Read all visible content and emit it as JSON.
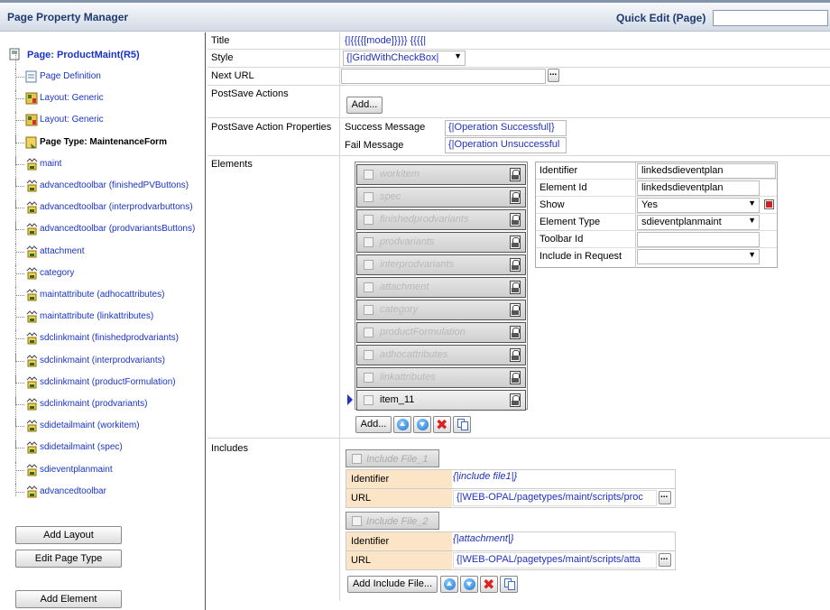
{
  "header": {
    "title": "Page Property Manager",
    "quick_edit_label": "Quick Edit (Page)",
    "quick_edit_value": ""
  },
  "tree": {
    "root": "Page: ProductMaint(R5)",
    "items": [
      {
        "label": "Page Definition",
        "bold": false,
        "icon": "page-doc-icon"
      },
      {
        "label": "Layout: Generic",
        "bold": false,
        "icon": "layout-icon"
      },
      {
        "label": "Layout: Generic",
        "bold": false,
        "icon": "layout-icon"
      },
      {
        "label": "Page Type: MaintenanceForm",
        "bold": true,
        "icon": "page-type-icon"
      },
      {
        "label": "maint",
        "bold": false,
        "icon": "element-icon"
      },
      {
        "label": "advancedtoolbar (finishedPVButtons)",
        "bold": false,
        "icon": "element-icon"
      },
      {
        "label": "advancedtoolbar (interprodvarbuttons)",
        "bold": false,
        "icon": "element-icon"
      },
      {
        "label": "advancedtoolbar (prodvariantsButtons)",
        "bold": false,
        "icon": "element-icon"
      },
      {
        "label": "attachment",
        "bold": false,
        "icon": "element-icon"
      },
      {
        "label": "category",
        "bold": false,
        "icon": "element-icon"
      },
      {
        "label": "maintattribute (adhocattributes)",
        "bold": false,
        "icon": "element-icon"
      },
      {
        "label": "maintattribute (linkattributes)",
        "bold": false,
        "icon": "element-icon"
      },
      {
        "label": "sdclinkmaint (finishedprodvariants)",
        "bold": false,
        "icon": "element-icon"
      },
      {
        "label": "sdclinkmaint (interprodvariants)",
        "bold": false,
        "icon": "element-icon"
      },
      {
        "label": "sdclinkmaint (productFormulation)",
        "bold": false,
        "icon": "element-icon"
      },
      {
        "label": "sdclinkmaint (prodvariants)",
        "bold": false,
        "icon": "element-icon"
      },
      {
        "label": "sdidetailmaint (workitem)",
        "bold": false,
        "icon": "element-icon"
      },
      {
        "label": "sdidetailmaint (spec)",
        "bold": false,
        "icon": "element-icon"
      },
      {
        "label": "sdieventplanmaint",
        "bold": false,
        "icon": "element-icon"
      },
      {
        "label": "advancedtoolbar",
        "bold": false,
        "icon": "element-icon"
      }
    ],
    "buttons": {
      "add_layout": "Add Layout",
      "edit_page_type": "Edit Page Type",
      "add_element": "Add Element"
    }
  },
  "main": {
    "title": {
      "label": "Title",
      "value": "{|{{{{[mode]}}}} {{{{|"
    },
    "style": {
      "label": "Style",
      "value": "{|GridWithCheckBox|"
    },
    "next_url": {
      "label": "Next URL",
      "value": ""
    },
    "postsave": {
      "label": "PostSave Actions",
      "add": "Add..."
    },
    "postsave_props": {
      "label": "PostSave Action Properties",
      "success_label": "Success Message",
      "success_value": "{|Operation Successful|}",
      "fail_label": "Fail Message",
      "fail_value": "{|Operation Unsuccessful"
    },
    "elements": {
      "label": "Elements",
      "items": [
        "workitem",
        "spec",
        "finishedprodvariants",
        "prodvariants",
        "interprodvariants",
        "attachment",
        "category",
        "productFormulation",
        "adhocattributes",
        "linkattributes",
        "item_11"
      ],
      "add": "Add...",
      "props": {
        "identifier_label": "Identifier",
        "identifier_value": "linkedsdieventplan",
        "element_id_label": "Element Id",
        "element_id_value": "linkedsdieventplan",
        "show_label": "Show",
        "show_value": "Yes",
        "type_label": "Element Type",
        "type_value": "sdieventplanmaint",
        "toolbar_label": "Toolbar Id",
        "toolbar_value": "",
        "include_label": "Include in Request",
        "include_value": ""
      }
    },
    "includes": {
      "label": "Includes",
      "files": [
        {
          "name": "Include File_1",
          "identifier_label": "Identifier",
          "identifier_value": "{|include file1|}",
          "url_label": "URL",
          "url_value": "{|WEB-OPAL/pagetypes/maint/scripts/proc"
        },
        {
          "name": "Include File_2",
          "identifier_label": "Identifier",
          "identifier_value": "{|attachment|}",
          "url_label": "URL",
          "url_value": "{|WEB-OPAL/pagetypes/maint/scripts/atta"
        }
      ],
      "add": "Add Include File..."
    }
  }
}
